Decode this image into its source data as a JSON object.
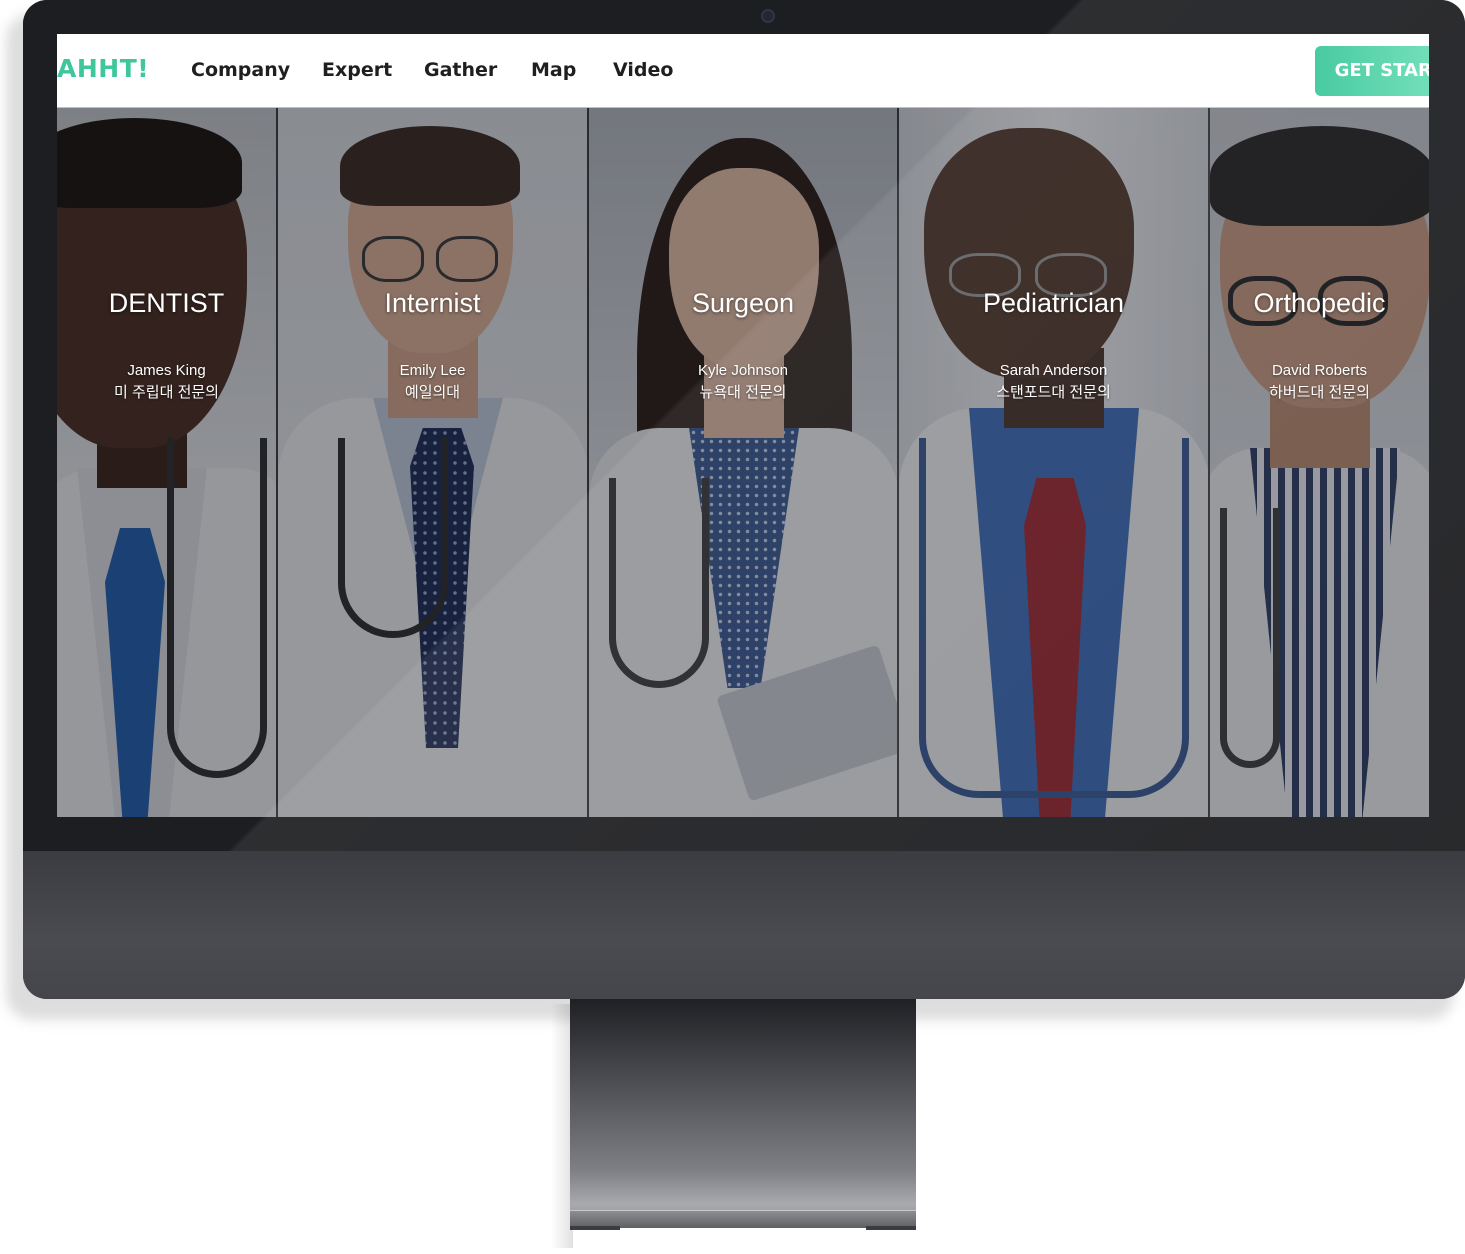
{
  "nav": {
    "logo": "AHHT!",
    "items": [
      "Company",
      "Expert",
      "Gather",
      "Map",
      "Video"
    ],
    "cta_label": "GET START"
  },
  "experts": [
    {
      "role": "DENTIST",
      "name": "James King",
      "school": "미 주립대 전문의"
    },
    {
      "role": "Internist",
      "name": "Emily Lee",
      "school": "예일의대"
    },
    {
      "role": "Surgeon",
      "name": "Kyle Johnson",
      "school": "뉴욕대 전문의"
    },
    {
      "role": "Pediatrician",
      "name": "Sarah Anderson",
      "school": "스탠포드대 전문의"
    },
    {
      "role": "Orthopedic",
      "name": "David Roberts",
      "school": "하버드대 전문의"
    }
  ],
  "colors": {
    "brand": "#3ec79c",
    "cta_gradient_start": "#3cc79a",
    "cta_gradient_end": "#6ee0b9",
    "overlay": "rgba(20,22,28,0.42)"
  },
  "icons": [
    "camera-icon"
  ]
}
